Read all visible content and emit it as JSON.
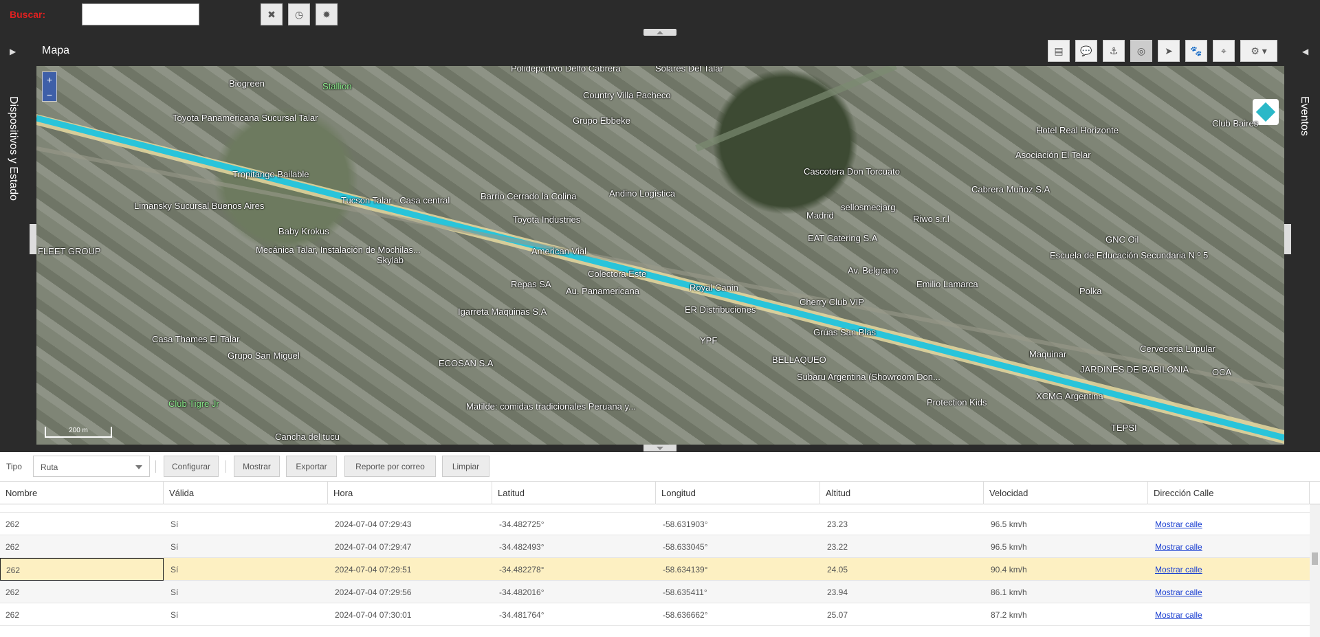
{
  "search": {
    "label": "Buscar:",
    "value": ""
  },
  "top_buttons": [
    "clear-icon",
    "clock-icon",
    "gear-icon"
  ],
  "left_panel": {
    "label": "Dispositivos y Estado"
  },
  "right_panel": {
    "label": "Eventos"
  },
  "map": {
    "title": "Mapa",
    "tools": [
      "document-icon",
      "chat-icon",
      "anchor-icon",
      "target-icon",
      "navigate-icon",
      "paw-icon",
      "crosshair-icon",
      "gear-icon"
    ],
    "zoom_in": "+",
    "zoom_out": "−",
    "scale": "200 m",
    "places": [
      "Polideportivo Delfo Cabrera",
      "Solares Del Talar",
      "Biogreen",
      "Stallion",
      "Country Villa Pacheco",
      "Grupo Ebbeke",
      "Toyota Panamericana Sucursal Talar",
      "Tropitango Bailable",
      "Tucson Talar - Casa central",
      "Barrio Cerrado la Colina",
      "Andino Logística",
      "Toyota Industries",
      "Limansky Sucursal Buenos Aires",
      "Baby Krokus",
      "FLEET GROUP",
      "Mecánica Talar, Instalación de Mochilas...",
      "Skylab",
      "American Vial",
      "Colectora Este",
      "Repas SA",
      "Au. Panamericana",
      "Royal Canin",
      "Igarreta Maquinas S.A",
      "ER Distribuciones",
      "Cherry Club VIP",
      "Grúas San Blas",
      "Casa Thames El Talar",
      "Grupo San Miguel",
      "YPF",
      "BELLAQUEO",
      "ECOSAN S.A",
      "Subaru Argentina (Showroom Don...",
      "Club Tigre Jr",
      "Matilde: comidas tradicionales Peruana y...",
      "Cancha del tucu",
      "Protection Kids",
      "XCMG Argentina",
      "JARDINES DE BABILONIA",
      "Cerveceria Lupular",
      "OCA",
      "TEPSI",
      "Hotel Real Horizonte",
      "Asociación El Telar",
      "Club Baires",
      "Cascotera Don Torcuato",
      "Cabrera Muñoz S.A",
      "sellosmecjarg",
      "Riwo s.r.l",
      "EAT Catering S.A",
      "GNC Oil",
      "Escuela de Educación Secundaria N.º 5",
      "Polka",
      "Maquinar",
      "Av. Belgrano",
      "Emilio Lamarca",
      "Madrid"
    ]
  },
  "filter": {
    "tipo_label": "Tipo",
    "tipo_value": "Ruta",
    "buttons": [
      "Configurar",
      "Mostrar",
      "Exportar",
      "Reporte por correo",
      "Limpiar"
    ]
  },
  "table": {
    "columns": [
      "Nombre",
      "Válida",
      "Hora",
      "Latitud",
      "Longitud",
      "Altitud",
      "Velocidad",
      "Dirección Calle"
    ],
    "rows": [
      [
        "262",
        "Sí",
        "2024-07-04 07:29:43",
        "-34.482725°",
        "-58.631903°",
        "23.23",
        "96.5 km/h",
        "Mostrar calle"
      ],
      [
        "262",
        "Sí",
        "2024-07-04 07:29:47",
        "-34.482493°",
        "-58.633045°",
        "23.22",
        "96.5 km/h",
        "Mostrar calle"
      ],
      [
        "262",
        "Sí",
        "2024-07-04 07:29:51",
        "-34.482278°",
        "-58.634139°",
        "24.05",
        "90.4 km/h",
        "Mostrar calle"
      ],
      [
        "262",
        "Sí",
        "2024-07-04 07:29:56",
        "-34.482016°",
        "-58.635411°",
        "23.94",
        "86.1 km/h",
        "Mostrar calle"
      ],
      [
        "262",
        "Sí",
        "2024-07-04 07:30:01",
        "-34.481764°",
        "-58.636662°",
        "25.07",
        "87.2 km/h",
        "Mostrar calle"
      ]
    ],
    "selected_row": 2
  }
}
